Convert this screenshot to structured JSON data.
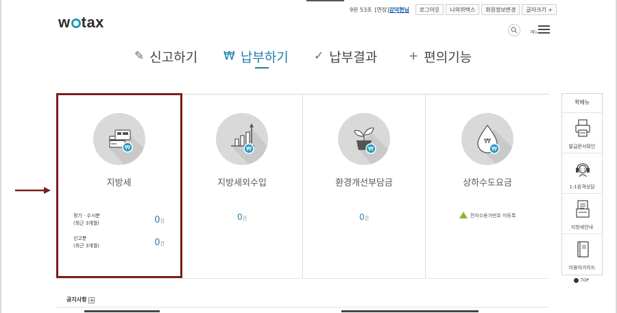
{
  "header": {
    "logo": "wetax",
    "timer": "9분 53초",
    "extend_label": "[연장]",
    "user": "강덕현님",
    "buttons": [
      "로그아웃",
      "나의위택스",
      "회원정보변경",
      "글자크기 +"
    ],
    "menu_label": "메뉴"
  },
  "nav": [
    {
      "label": "신고하기",
      "icon": "pencil-icon",
      "active": false
    },
    {
      "label": "납부하기",
      "icon": "won-icon",
      "active": true
    },
    {
      "label": "납부결과",
      "icon": "check-icon",
      "active": false
    },
    {
      "label": "편의기능",
      "icon": "plus-icon",
      "active": false
    }
  ],
  "cards": [
    {
      "title": "지방세",
      "icon": "card-payment-icon",
      "rows": [
        {
          "label_line1": "정기 · 수시분",
          "label_line2": "(최근 3개월)",
          "value": "0",
          "unit": "건"
        },
        {
          "label_line1": "신고분",
          "label_line2": "(최근 3개월)",
          "value": "0",
          "unit": "건"
        }
      ]
    },
    {
      "title": "지방세외수입",
      "icon": "bar-chart-icon",
      "value": "0",
      "unit": "건"
    },
    {
      "title": "환경개선부담금",
      "icon": "plant-pot-icon",
      "value": "0",
      "unit": "건"
    },
    {
      "title": "상하수도요금",
      "icon": "water-drop-icon",
      "notice": "전자수용가번호 미등록"
    }
  ],
  "notice": {
    "label": "공지사항",
    "plus": "+"
  },
  "quick_menu": {
    "title": "퀵메뉴",
    "items": [
      {
        "label": "발급문서확인",
        "icon": "printer-icon"
      },
      {
        "label": "1:1원격상담",
        "icon": "headset-icon"
      },
      {
        "label": "지방세안내",
        "icon": "document-icon"
      },
      {
        "label": "이용자가이드",
        "icon": "book-icon"
      }
    ],
    "top_label": "TOP"
  },
  "colors": {
    "accent": "#1e7fa8",
    "highlight": "#7a1c1c",
    "icon_bg": "#d9d9d9",
    "badge": "#2a9cbf"
  }
}
